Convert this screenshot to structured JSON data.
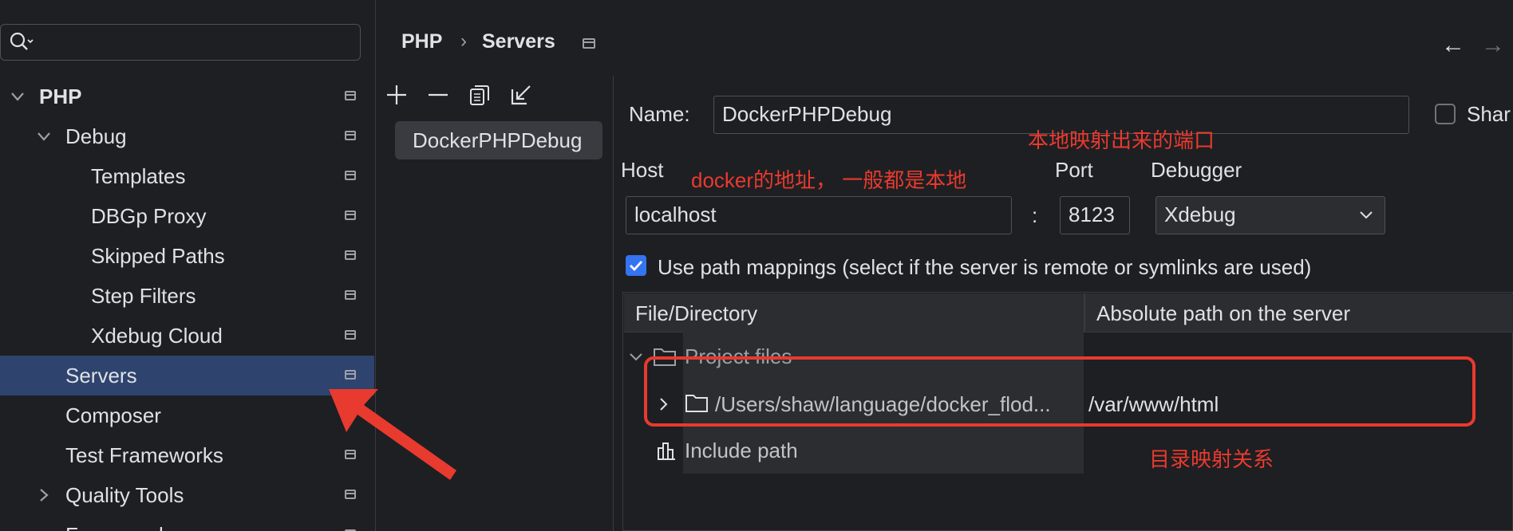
{
  "search": {
    "icon": "search-icon",
    "value": ""
  },
  "tree": {
    "items": [
      {
        "label": "PHP",
        "bold": true
      },
      {
        "label": "Debug"
      },
      {
        "label": "Templates"
      },
      {
        "label": "DBGp Proxy"
      },
      {
        "label": "Skipped Paths"
      },
      {
        "label": "Step Filters"
      },
      {
        "label": "Xdebug Cloud"
      },
      {
        "label": "Servers",
        "selected": true
      },
      {
        "label": "Composer"
      },
      {
        "label": "Test Frameworks"
      },
      {
        "label": "Quality Tools"
      },
      {
        "label": "Frameworks"
      }
    ]
  },
  "breadcrumb": {
    "root": "PHP",
    "separator": "›",
    "current": "Servers"
  },
  "nav": {
    "back": "←",
    "forward": "→"
  },
  "server_list": {
    "toolbar": [
      "add-icon",
      "remove-icon",
      "copy-icon",
      "import-icon"
    ],
    "items": [
      "DockerPHPDebug"
    ]
  },
  "form": {
    "name_label": "Name:",
    "name_value": "DockerPHPDebug",
    "shared_label": "Shar",
    "shared_checked": false,
    "host_label": "Host",
    "host_value": "localhost",
    "colon": ":",
    "port_label": "Port",
    "port_value": "8123",
    "debugger_label": "Debugger",
    "debugger_value": "Xdebug",
    "use_mappings_label": "Use path mappings (select if the server is remote or symlinks are used)",
    "use_mappings_checked": true
  },
  "mappings": {
    "col_file": "File/Directory",
    "col_server": "Absolute path on the server",
    "project_files": "Project files",
    "local_path": "/Users/shaw/language/docker_flod...",
    "server_path": "/var/www/html",
    "include_path": "Include path"
  },
  "annotations": {
    "port_note": "本地映射出来的端口",
    "host_note": "docker的地址， 一般都是本地",
    "mapping_note": "目录映射关系"
  },
  "colors": {
    "background": "#1e1f22",
    "selection": "#2e436e",
    "accent": "#3574f0",
    "annotation": "#e83a2f"
  }
}
